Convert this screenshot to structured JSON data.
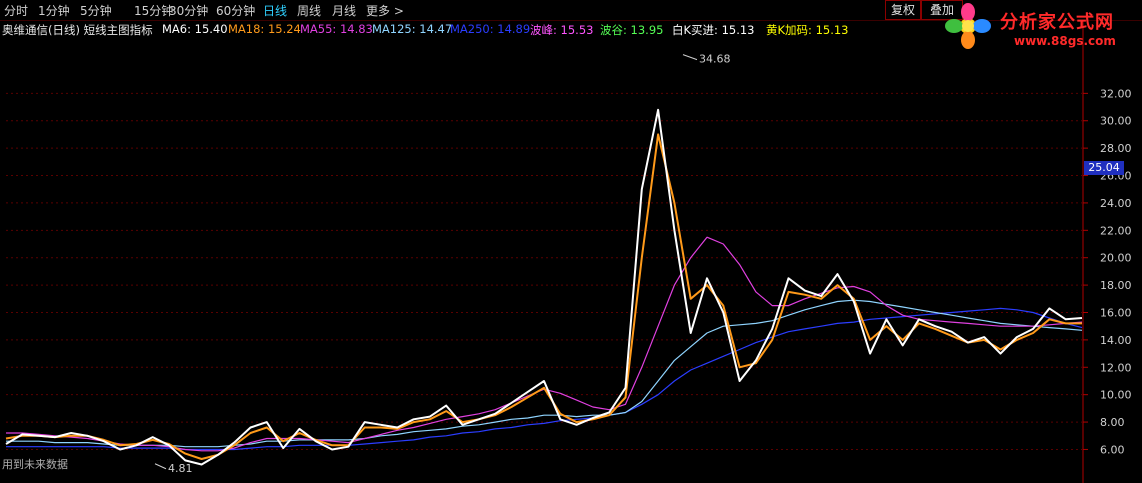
{
  "toolbar": {
    "timeframes": [
      {
        "label": "分时",
        "active": false
      },
      {
        "label": "1分钟",
        "active": false
      },
      {
        "label": "5分钟",
        "active": false
      },
      {
        "label": "15分钟",
        "active": false
      },
      {
        "label": "30分钟",
        "active": false
      },
      {
        "label": "60分钟",
        "active": false
      },
      {
        "label": "日线",
        "active": true
      },
      {
        "label": "周线",
        "active": false
      },
      {
        "label": "月线",
        "active": false
      },
      {
        "label": "更多 >",
        "active": false
      }
    ],
    "fuquan_label": "复权",
    "die_label": "叠加"
  },
  "logo": {
    "site_name": "分析家公式网",
    "url": "www.88gs.com"
  },
  "legend": {
    "title": "奥维通信(日线) 短线主图指标",
    "items": [
      {
        "label": "MA6: 15.40",
        "color": "#ffffff"
      },
      {
        "label": "MA18: 15.24",
        "color": "#ff9a1a"
      },
      {
        "label": "MA55: 14.83",
        "color": "#e040e0"
      },
      {
        "label": "MA125: 14.47",
        "color": "#8fd4ff"
      },
      {
        "label": "MA250: 14.89",
        "color": "#2b3dff"
      },
      {
        "label": "波峰: 15.53",
        "color": "#ff55ff"
      },
      {
        "label": "波谷: 13.95",
        "color": "#55ff55"
      },
      {
        "label": "白K买进: 15.13",
        "color": "#ffffff"
      },
      {
        "label": "黄K加码: 15.13",
        "color": "#ffff00"
      }
    ]
  },
  "bottom_note": "用到未来数据",
  "chart_data": {
    "type": "line",
    "y_ticks": [
      "32.00",
      "30.00",
      "28.00",
      "26.00",
      "24.00",
      "22.00",
      "20.00",
      "18.00",
      "16.00",
      "14.00",
      "12.00",
      "10.00",
      "8.00",
      "6.00"
    ],
    "ylim": [
      4.5,
      34.8
    ],
    "current_price": "25.04",
    "annotations": {
      "high": "34.68",
      "low": "4.81"
    },
    "series": [
      {
        "name": "MA6",
        "color": "#ffffff",
        "values": [
          6.4,
          7.1,
          7.0,
          6.9,
          7.2,
          7.0,
          6.6,
          6.0,
          6.3,
          6.9,
          6.3,
          5.2,
          4.9,
          5.6,
          6.5,
          7.6,
          8.0,
          6.1,
          7.5,
          6.6,
          6.0,
          6.2,
          8.0,
          7.8,
          7.6,
          8.2,
          8.4,
          9.2,
          7.8,
          8.2,
          8.6,
          9.4,
          10.2,
          11.0,
          8.2,
          7.8,
          8.3,
          8.7,
          10.5,
          25.0,
          30.8,
          22.0,
          14.5,
          18.5,
          16.0,
          11.0,
          12.5,
          14.8,
          18.5,
          17.6,
          17.2,
          18.8,
          16.8,
          13.0,
          15.5,
          13.6,
          15.5,
          15.0,
          14.6,
          13.8,
          14.2,
          13.0,
          14.2,
          14.8,
          16.3,
          15.5,
          15.6
        ]
      },
      {
        "name": "MA18",
        "color": "#ff9a1a",
        "values": [
          6.8,
          7.0,
          7.0,
          6.9,
          7.0,
          7.0,
          6.7,
          6.3,
          6.4,
          6.7,
          6.4,
          5.7,
          5.3,
          5.6,
          6.3,
          7.2,
          7.6,
          6.6,
          7.2,
          6.7,
          6.3,
          6.3,
          7.6,
          7.6,
          7.5,
          8.0,
          8.2,
          8.8,
          8.0,
          8.2,
          8.5,
          9.1,
          9.8,
          10.5,
          8.6,
          8.0,
          8.2,
          8.5,
          9.8,
          20.0,
          29.0,
          24.0,
          17.0,
          18.0,
          16.5,
          12.0,
          12.3,
          14.0,
          17.5,
          17.3,
          17.0,
          18.0,
          17.0,
          14.0,
          15.0,
          14.0,
          15.2,
          14.8,
          14.3,
          13.8,
          14.0,
          13.3,
          14.0,
          14.5,
          15.5,
          15.2,
          15.2
        ]
      },
      {
        "name": "MA55",
        "color": "#e040e0",
        "values": [
          7.2,
          7.2,
          7.1,
          7.0,
          6.9,
          6.8,
          6.6,
          6.4,
          6.3,
          6.3,
          6.2,
          6.0,
          5.9,
          5.9,
          6.1,
          6.5,
          6.8,
          6.8,
          6.8,
          6.7,
          6.6,
          6.5,
          6.8,
          7.1,
          7.4,
          7.6,
          7.9,
          8.2,
          8.4,
          8.6,
          8.9,
          9.4,
          9.9,
          10.4,
          10.1,
          9.6,
          9.1,
          8.9,
          9.3,
          12.0,
          15.0,
          18.0,
          20.0,
          21.5,
          21.0,
          19.5,
          17.5,
          16.5,
          16.5,
          17.0,
          17.4,
          17.8,
          17.9,
          17.5,
          16.5,
          15.8,
          15.5,
          15.4,
          15.3,
          15.2,
          15.1,
          15.0,
          15.0,
          15.0,
          15.1,
          15.2,
          15.3
        ]
      },
      {
        "name": "MA125",
        "color": "#8fd4ff",
        "values": [
          6.6,
          6.6,
          6.6,
          6.5,
          6.5,
          6.5,
          6.4,
          6.3,
          6.3,
          6.3,
          6.3,
          6.2,
          6.2,
          6.2,
          6.3,
          6.4,
          6.6,
          6.6,
          6.7,
          6.7,
          6.7,
          6.7,
          6.8,
          7.0,
          7.1,
          7.3,
          7.4,
          7.5,
          7.7,
          7.8,
          8.0,
          8.2,
          8.3,
          8.5,
          8.5,
          8.4,
          8.5,
          8.5,
          8.7,
          9.5,
          11.0,
          12.5,
          13.5,
          14.5,
          15.0,
          15.1,
          15.2,
          15.4,
          15.8,
          16.2,
          16.5,
          16.8,
          16.9,
          16.8,
          16.6,
          16.4,
          16.2,
          16.0,
          15.8,
          15.6,
          15.4,
          15.2,
          15.1,
          15.0,
          14.9,
          14.8,
          14.7
        ]
      },
      {
        "name": "MA250",
        "color": "#2b3dff",
        "values": [
          6.2,
          6.2,
          6.2,
          6.2,
          6.2,
          6.2,
          6.2,
          6.1,
          6.1,
          6.1,
          6.1,
          6.0,
          6.0,
          6.0,
          6.0,
          6.1,
          6.2,
          6.2,
          6.3,
          6.3,
          6.3,
          6.3,
          6.4,
          6.5,
          6.6,
          6.7,
          6.9,
          7.0,
          7.2,
          7.3,
          7.5,
          7.6,
          7.8,
          7.9,
          8.1,
          8.2,
          8.3,
          8.5,
          8.7,
          9.3,
          10.0,
          11.0,
          11.8,
          12.3,
          12.8,
          13.3,
          13.8,
          14.2,
          14.6,
          14.8,
          15.0,
          15.2,
          15.3,
          15.5,
          15.6,
          15.7,
          15.8,
          15.9,
          16.0,
          16.1,
          16.2,
          16.3,
          16.2,
          16.0,
          15.6,
          15.2,
          14.9
        ]
      }
    ]
  }
}
